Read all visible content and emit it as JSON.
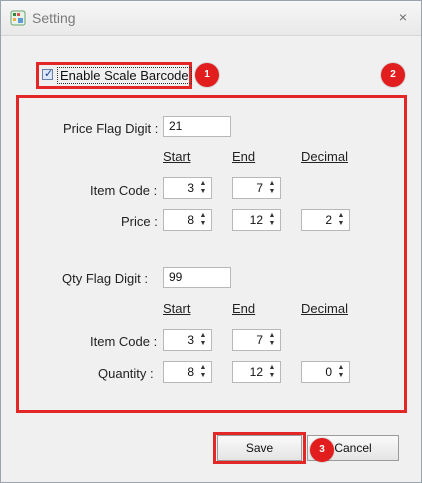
{
  "window": {
    "title": "Setting",
    "close_glyph": "×"
  },
  "enable_scale_barcode": {
    "label": "Enable Scale Barcode",
    "checked": true
  },
  "badges": [
    "1",
    "2",
    "3"
  ],
  "price_section": {
    "flag_label": "Price Flag Digit :",
    "flag_value": "21",
    "headers": {
      "start": "Start",
      "end": "End",
      "decimal": "Decimal"
    },
    "rows": [
      {
        "label": "Item Code :",
        "start": "3",
        "end": "7"
      },
      {
        "label": "Price :",
        "start": "8",
        "end": "12",
        "decimal": "2"
      }
    ]
  },
  "qty_section": {
    "flag_label": "Qty Flag Digit :",
    "flag_value": "99",
    "headers": {
      "start": "Start",
      "end": "End",
      "decimal": "Decimal"
    },
    "rows": [
      {
        "label": "Item Code :",
        "start": "3",
        "end": "7"
      },
      {
        "label": "Quantity :",
        "start": "8",
        "end": "12",
        "decimal": "0"
      }
    ]
  },
  "buttons": {
    "save": "Save",
    "cancel": "Cancel"
  },
  "spin_glyphs": {
    "up": "▲",
    "down": "▼"
  },
  "colors": {
    "annotation_red": "#e32626"
  }
}
